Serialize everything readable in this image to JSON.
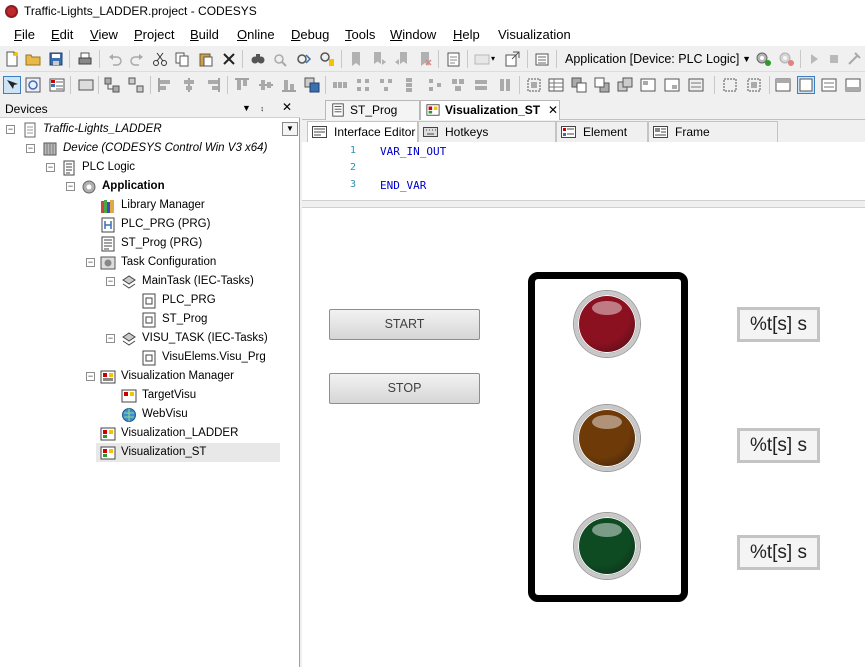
{
  "window": {
    "title": "Traffic-Lights_LADDER.project - CODESYS"
  },
  "menu": {
    "items": [
      {
        "label": "File",
        "underline": "F",
        "rest": "ile"
      },
      {
        "label": "Edit",
        "underline": "E",
        "rest": "dit"
      },
      {
        "label": "View",
        "underline": "V",
        "rest": "iew"
      },
      {
        "label": "Project",
        "underline": "P",
        "rest": "roject"
      },
      {
        "label": "Build",
        "underline": "B",
        "rest": "uild"
      },
      {
        "label": "Online",
        "underline": "O",
        "rest": "nline"
      },
      {
        "label": "Debug",
        "underline": "D",
        "rest": "ebug"
      },
      {
        "label": "Tools",
        "underline": "T",
        "rest": "ools"
      },
      {
        "label": "Window",
        "underline": "W",
        "rest": "indow"
      },
      {
        "label": "Help",
        "underline": "H",
        "rest": "elp"
      },
      {
        "label": "Visualization",
        "underline": "",
        "rest": "Visualization"
      }
    ]
  },
  "toolbar": {
    "application_combo": "Application [Device: PLC Logic]"
  },
  "devices_panel": {
    "title": "Devices",
    "pin_glyph": "⨾",
    "close_glyph": "✕",
    "dropdown_glyph": "▼",
    "tree": [
      {
        "label": "Traffic-Lights_LADDER",
        "italic": true
      },
      {
        "label": "Device (CODESYS Control Win V3 x64)",
        "italic": true
      },
      {
        "label": "PLC Logic"
      },
      {
        "label": "Application",
        "bold": true
      },
      {
        "label": "Library Manager"
      },
      {
        "label": "PLC_PRG (PRG)"
      },
      {
        "label": "ST_Prog (PRG)"
      },
      {
        "label": "Task Configuration"
      },
      {
        "label": "MainTask (IEC-Tasks)"
      },
      {
        "label": "PLC_PRG"
      },
      {
        "label": "ST_Prog"
      },
      {
        "label": "VISU_TASK (IEC-Tasks)"
      },
      {
        "label": "VisuElems.Visu_Prg"
      },
      {
        "label": "Visualization Manager"
      },
      {
        "label": "TargetVisu"
      },
      {
        "label": "WebVisu"
      },
      {
        "label": "Visualization_LADDER"
      },
      {
        "label": "Visualization_ST"
      }
    ]
  },
  "editor": {
    "tabs": [
      {
        "label": "ST_Prog"
      },
      {
        "label": "Visualization_ST",
        "close": "✕"
      }
    ],
    "subtabs": [
      {
        "label": "Interface Editor"
      },
      {
        "label": "Hotkeys Configuration"
      },
      {
        "label": "Element List"
      },
      {
        "label": "Frame Configuration"
      }
    ],
    "code": [
      {
        "n": "1",
        "text": "VAR_IN_OUT"
      },
      {
        "n": "2",
        "text": ""
      },
      {
        "n": "3",
        "text": "END_VAR"
      }
    ]
  },
  "visualization": {
    "start_label": "START",
    "stop_label": "STOP",
    "time_label_red": "%t[s] s",
    "time_label_yellow": "%t[s] s",
    "time_label_green": "%t[s] s",
    "colors": {
      "red": "#8b1020",
      "yellow": "#6e3a08",
      "green": "#0e4a22"
    }
  }
}
